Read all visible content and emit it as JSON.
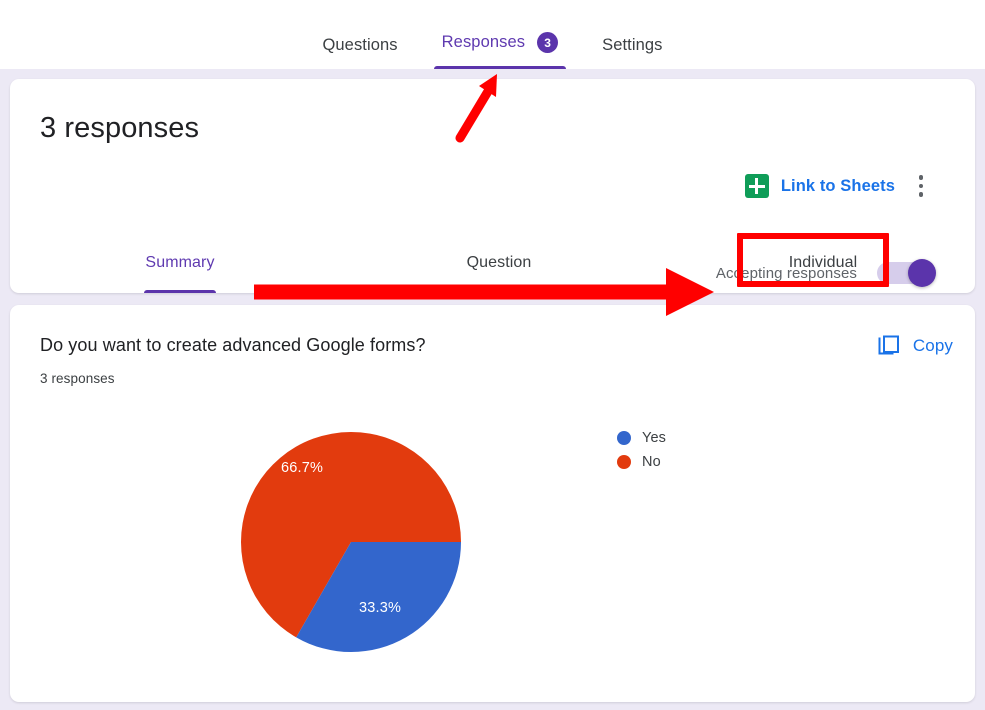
{
  "topnav": {
    "tabs": [
      {
        "label": "Questions",
        "active": false
      },
      {
        "label": "Responses",
        "active": true,
        "badge": "3"
      },
      {
        "label": "Settings",
        "active": false
      }
    ]
  },
  "summary_card": {
    "title": "3 responses",
    "sheets_link_label": "Link to Sheets",
    "sheets_icon": "google-sheets-icon",
    "more_icon": "more-vert-icon",
    "accepting_label": "Accepting responses",
    "accepting_state": "on",
    "subtabs": [
      {
        "label": "Summary",
        "active": true
      },
      {
        "label": "Question",
        "active": false
      },
      {
        "label": "Individual",
        "active": false
      }
    ]
  },
  "question_card": {
    "question": "Do you want to create advanced Google forms?",
    "responses": "3 responses",
    "copy_label": "Copy",
    "copy_icon": "copy-icon"
  },
  "chart_data": {
    "type": "pie",
    "title": "Do you want to create advanced Google forms?",
    "categories": [
      "Yes",
      "No"
    ],
    "values": [
      33.3,
      66.7
    ],
    "value_labels": [
      "33.3%",
      "66.7%"
    ],
    "counts": [
      1,
      2
    ],
    "colors": [
      "#3366cc",
      "#e23b0e"
    ],
    "legend_position": "right",
    "labels_inside": true,
    "total_responses": 3
  },
  "annotations": {
    "color": "#ff0000",
    "items": [
      {
        "name": "highlight-box-individual",
        "shape": "rectangle",
        "target": "Individual"
      },
      {
        "name": "arrow-to-individual",
        "shape": "arrow-right",
        "target": "Individual"
      },
      {
        "name": "arrow-to-responses-tab",
        "shape": "arrow-diagonal",
        "target": "Responses"
      }
    ]
  },
  "colors": {
    "page_background": "#ece9f5",
    "card_background": "#ffffff",
    "accent_purple": "#5b34ab",
    "link_blue": "#1a73e8",
    "sheets_green": "#0f9d58"
  }
}
